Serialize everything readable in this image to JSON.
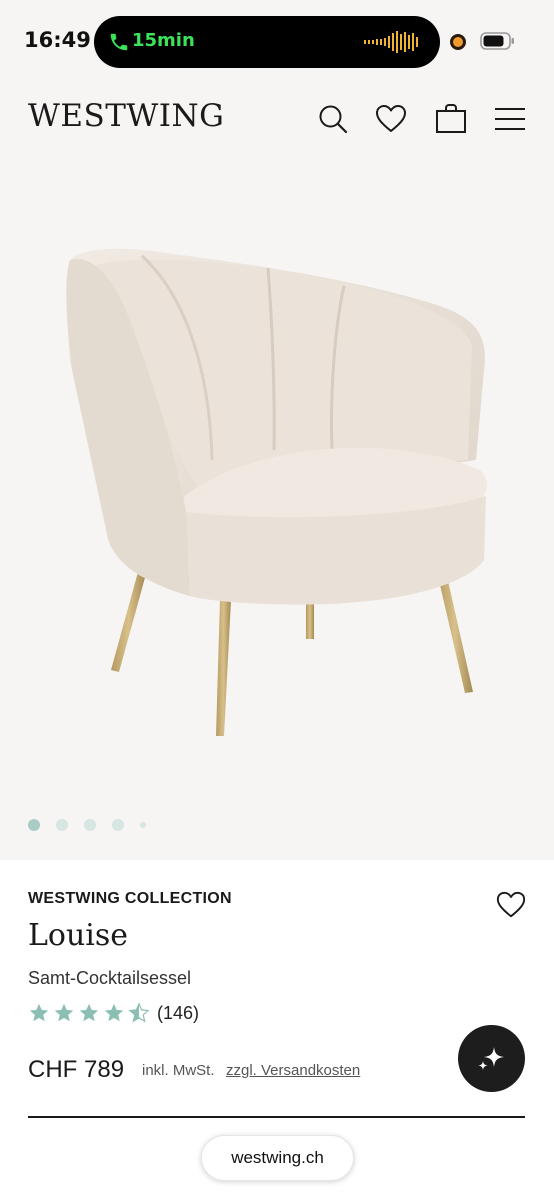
{
  "status_bar": {
    "time": "16:49",
    "call_timer": "15min",
    "call_color": "#3be35a",
    "recording_indicator_color": "#f29a2e"
  },
  "header": {
    "logo": "WESTWING",
    "icons": [
      "search-icon",
      "heart-icon",
      "bag-icon",
      "menu-icon"
    ]
  },
  "gallery": {
    "image": "velvet cocktail chair with gold legs",
    "image_count": 5,
    "active_index": 0,
    "accent_color": "#a9cdc4"
  },
  "product": {
    "brand": "WESTWING COLLECTION",
    "name": "Louise",
    "subtitle": "Samt-Cocktailsessel",
    "rating": 4.5,
    "rating_max": 5,
    "review_count": "(146)",
    "price": "CHF 789",
    "tax_note": "inkl. MwSt.",
    "shipping_link": "zzgl. Versandkosten"
  },
  "browser": {
    "url": "westwing.ch"
  }
}
